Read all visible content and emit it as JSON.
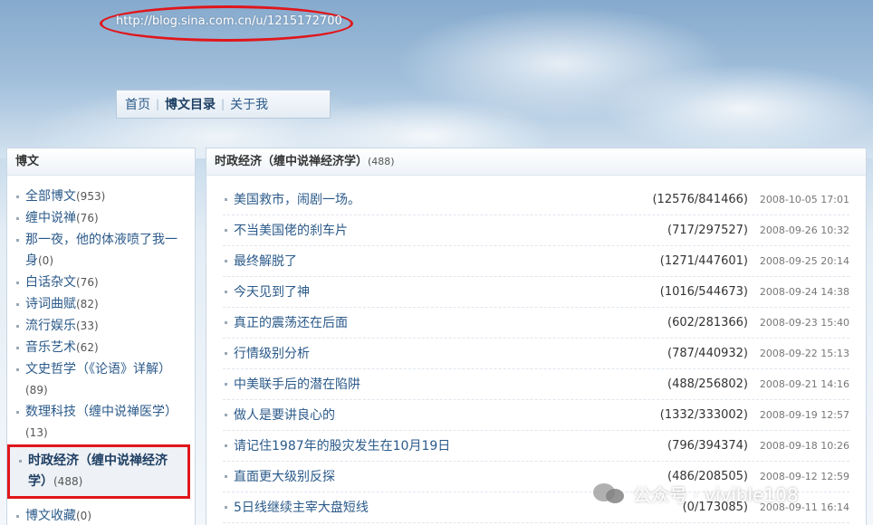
{
  "header": {
    "url": "http://blog.sina.com.cn/u/1215172700",
    "nav": [
      {
        "label": "首页"
      },
      {
        "label": "博文目录"
      },
      {
        "label": "关于我"
      }
    ]
  },
  "sidebar": {
    "title": "博文",
    "categories": [
      {
        "label": "全部博文",
        "count": "(953)"
      },
      {
        "label": "缠中说禅",
        "count": "(76)"
      },
      {
        "label": "那一夜，他的体液喷了我一身",
        "count": "(0)"
      },
      {
        "label": "白话杂文",
        "count": "(76)"
      },
      {
        "label": "诗词曲赋",
        "count": "(82)"
      },
      {
        "label": "流行娱乐",
        "count": "(33)"
      },
      {
        "label": "音乐艺术",
        "count": "(62)"
      },
      {
        "label": "文史哲学（《论语》详解）",
        "count": "(89)"
      },
      {
        "label": "数理科技（缠中说禅医学）",
        "count": "(13)"
      },
      {
        "label": "时政经济（缠中说禅经济学）",
        "count": "(488)"
      },
      {
        "label": "博文收藏",
        "count": "(0)"
      }
    ]
  },
  "main": {
    "title": "时政经济（缠中说禅经济学）",
    "count": "(488)",
    "articles": [
      {
        "title": "美国救市，闹剧一场。",
        "stats": "(12576/841466)",
        "date": "2008-10-05 17:01"
      },
      {
        "title": "不当美国佬的刹车片",
        "stats": "(717/297527)",
        "date": "2008-09-26 10:32"
      },
      {
        "title": "最终解脱了",
        "stats": "(1271/447601)",
        "date": "2008-09-25 20:14"
      },
      {
        "title": "今天见到了神",
        "stats": "(1016/544673)",
        "date": "2008-09-24 14:38"
      },
      {
        "title": "真正的震荡还在后面",
        "stats": "(602/281366)",
        "date": "2008-09-23 15:40"
      },
      {
        "title": "行情级别分析",
        "stats": "(787/440932)",
        "date": "2008-09-22 15:13"
      },
      {
        "title": "中美联手后的潜在陷阱",
        "stats": "(488/256802)",
        "date": "2008-09-21 14:16"
      },
      {
        "title": "做人是要讲良心的",
        "stats": "(1332/333002)",
        "date": "2008-09-19 12:57"
      },
      {
        "title": "请记住1987年的股灾发生在10月19日",
        "stats": "(796/394374)",
        "date": "2008-09-18 10:26"
      },
      {
        "title": "直面更大级别反探",
        "stats": "(486/208505)",
        "date": "2008-09-12 12:59"
      },
      {
        "title": "5日线继续主宰大盘短线",
        "stats": "(0/173085)",
        "date": "2008-09-11 16:14"
      }
    ]
  },
  "watermark": {
    "text": "公众号 · vivible108",
    "icon": "wechat-icon"
  },
  "colors": {
    "link": "#2b5a8a",
    "highlight_border": "#e0161b"
  }
}
